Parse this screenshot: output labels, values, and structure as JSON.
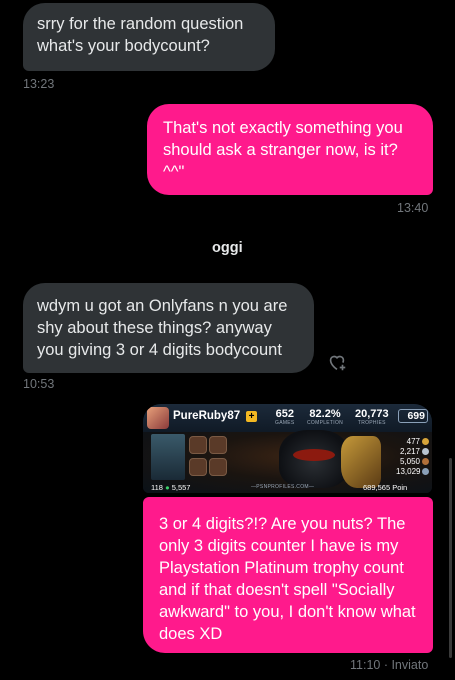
{
  "messages": [
    {
      "dir": "in",
      "text": "srry for the random question what's your bodycount?",
      "time": "13:23"
    },
    {
      "dir": "out",
      "text": "That's not exactly something you should ask a stranger now, is it? ^^\"",
      "time": "13:40"
    },
    {
      "dir": "in",
      "text": "wdym u got an Onlyfans n you are shy about these things? anyway you giving 3 or 4 digits bodycount",
      "time": "10:53"
    },
    {
      "dir": "out",
      "text": "3 or 4 digits?!? Are you nuts? The only 3 digits counter I have is my Playstation Platinum trophy count and if that doesn't spell \"Socially awkward\" to you, I don't know what does XD",
      "time": "11:10 · Inviato"
    }
  ],
  "day_label": "oggi",
  "icons": {
    "react": "heart-plus-icon"
  },
  "trophy_card": {
    "username": "PureRuby87",
    "games": "652",
    "games_label": "GAMES",
    "completion": "82.2%",
    "completion_label": "COMPLETION",
    "trophies": "20,773",
    "trophies_label": "TROPHIES",
    "platinum": "699",
    "gold": "477",
    "silver": "2,217",
    "bronze": "5,050",
    "total": "13,029",
    "level": "118",
    "level_progress": "5,557",
    "site": "—PSNPROFILES.COM—",
    "points": "689,565 Poin"
  },
  "colors": {
    "outgoing": "#ff1a8c",
    "incoming": "#2f3336",
    "meta": "#71767b"
  }
}
